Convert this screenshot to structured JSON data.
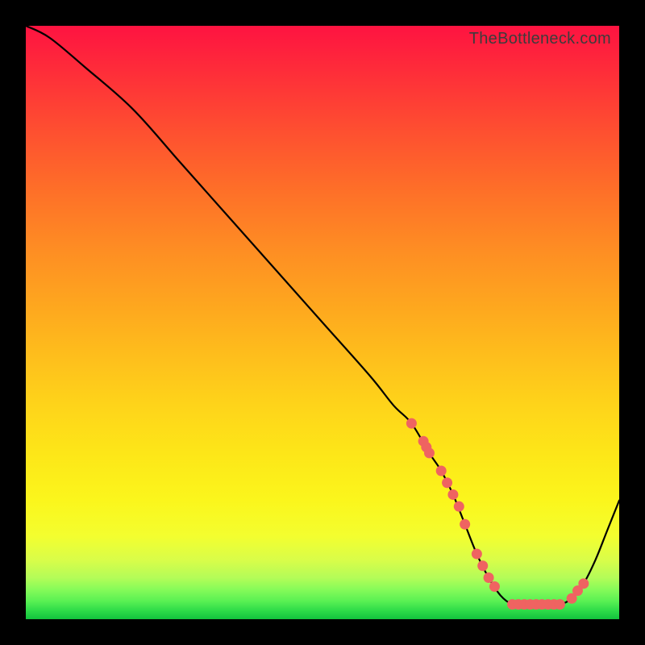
{
  "watermark": "TheBottleneck.com",
  "chart_data": {
    "type": "line",
    "title": "",
    "xlabel": "",
    "ylabel": "",
    "xlim": [
      0,
      100
    ],
    "ylim": [
      0,
      100
    ],
    "series": [
      {
        "name": "curve",
        "x": [
          0,
          4,
          10,
          18,
          26,
          34,
          42,
          50,
          58,
          62,
          65,
          68,
          70,
          72,
          74,
          76,
          78,
          80,
          82,
          84,
          86,
          88,
          90,
          92,
          94,
          96,
          98,
          100
        ],
        "y": [
          100,
          98,
          93,
          86,
          77,
          68,
          59,
          50,
          41,
          36,
          33,
          28,
          25,
          21,
          16,
          11,
          7,
          4,
          2.5,
          2.5,
          2.5,
          2.5,
          2.5,
          3.5,
          6,
          10,
          15,
          20
        ]
      }
    ],
    "markers": {
      "name": "highlight-dots",
      "color": "#ef6361",
      "x": [
        65,
        67,
        67.5,
        68,
        70,
        71,
        72,
        73,
        74,
        76,
        77,
        78,
        79,
        82,
        83,
        84,
        85,
        86,
        87,
        88,
        89,
        90,
        92,
        93,
        94
      ],
      "y": [
        33,
        30,
        29,
        28,
        25,
        23,
        21,
        19,
        16,
        11,
        9,
        7,
        5.5,
        2.5,
        2.5,
        2.5,
        2.5,
        2.5,
        2.5,
        2.5,
        2.5,
        2.5,
        3.5,
        4.8,
        6
      ]
    }
  }
}
